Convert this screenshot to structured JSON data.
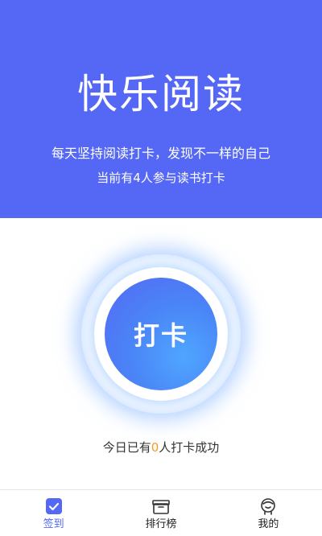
{
  "hero": {
    "title": "快乐阅读",
    "subtitle": "每天坚持阅读打卡，发现不一样的自己",
    "participants_prefix": "当前有",
    "participants_count": "4",
    "participants_suffix": "人参与读书打卡"
  },
  "checkin": {
    "button_label": "打卡"
  },
  "today": {
    "prefix": "今日已有",
    "count": "0",
    "suffix": "人打卡成功"
  },
  "tabbar": {
    "tabs": [
      {
        "label": "签到",
        "icon": "checkbox-icon",
        "active": true
      },
      {
        "label": "排行榜",
        "icon": "gift-box-icon",
        "active": false
      },
      {
        "label": "我的",
        "icon": "user-icon",
        "active": false
      }
    ]
  },
  "colors": {
    "brand": "#5468f5",
    "highlight": "#f59a23"
  }
}
